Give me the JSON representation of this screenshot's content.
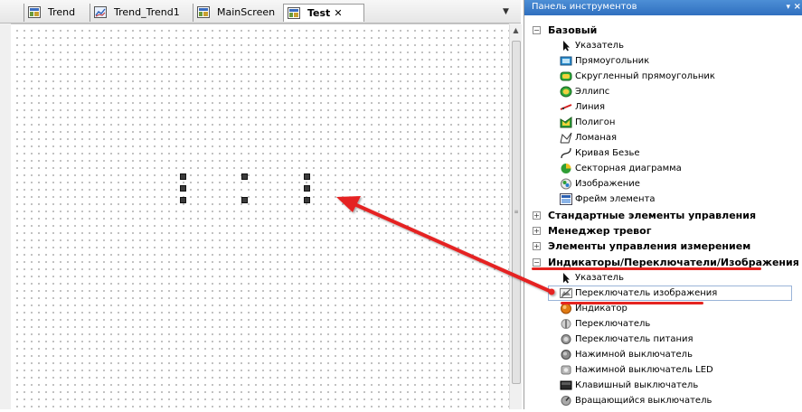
{
  "tabs": [
    {
      "label": "Trend",
      "icon": "visualization-icon"
    },
    {
      "label": "Trend_Trend1",
      "icon": "trend-icon"
    },
    {
      "label": "MainScreen",
      "icon": "visualization-icon"
    },
    {
      "label": "Test",
      "icon": "visualization-icon",
      "active": true,
      "close": "✕"
    }
  ],
  "toolbox": {
    "title": "Панель инструментов",
    "pin": "▾",
    "close": "×",
    "categories": [
      {
        "label": "Базовый",
        "expanded": true,
        "toggle": "−",
        "items": [
          {
            "label": "Указатель",
            "icon": "pointer-icon"
          },
          {
            "label": "Прямоугольник",
            "icon": "rectangle-icon"
          },
          {
            "label": "Скругленный прямоугольник",
            "icon": "rounded-rectangle-icon"
          },
          {
            "label": "Эллипс",
            "icon": "ellipse-icon"
          },
          {
            "label": "Линия",
            "icon": "line-icon"
          },
          {
            "label": "Полигон",
            "icon": "polygon-icon"
          },
          {
            "label": "Ломаная",
            "icon": "polyline-icon"
          },
          {
            "label": "Кривая Безье",
            "icon": "bezier-curve-icon"
          },
          {
            "label": "Секторная диаграмма",
            "icon": "pie-chart-icon"
          },
          {
            "label": "Изображение",
            "icon": "image-icon"
          },
          {
            "label": "Фрейм элемента",
            "icon": "element-frame-icon"
          }
        ]
      },
      {
        "label": "Стандартные элементы управления",
        "expanded": false,
        "toggle": "+"
      },
      {
        "label": "Менеджер тревог",
        "expanded": false,
        "toggle": "+"
      },
      {
        "label": "Элементы управления измерением",
        "expanded": false,
        "toggle": "+"
      },
      {
        "label": "Индикаторы/Переключатели/Изображения",
        "expanded": true,
        "toggle": "−",
        "items": [
          {
            "label": "Указатель",
            "icon": "pointer-icon"
          },
          {
            "label": "Переключатель изображения",
            "icon": "image-switcher-icon",
            "selected": true
          },
          {
            "label": "Индикатор",
            "icon": "lamp-indicator-icon"
          },
          {
            "label": "Переключатель",
            "icon": "switch-icon"
          },
          {
            "label": "Переключатель питания",
            "icon": "power-switch-icon"
          },
          {
            "label": "Нажимной выключатель",
            "icon": "push-switch-icon"
          },
          {
            "label": "Нажимной выключатель LED",
            "icon": "push-switch-led-icon"
          },
          {
            "label": "Клавишный выключатель",
            "icon": "rocker-switch-icon"
          },
          {
            "label": "Вращающийся выключатель",
            "icon": "rotary-switch-icon"
          }
        ]
      }
    ]
  },
  "colors": {
    "accent_header": "#2f6fbf",
    "annotation_red": "#e52420",
    "selection_border": "#9ab4d8"
  }
}
